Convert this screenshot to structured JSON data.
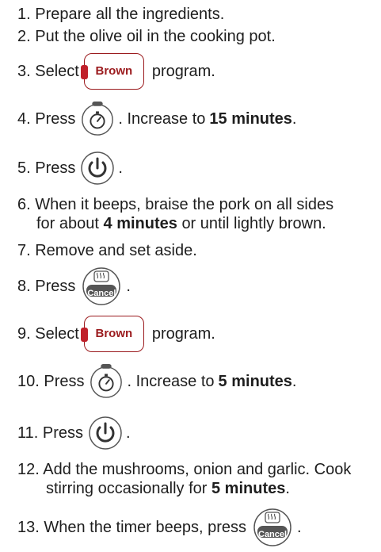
{
  "steps": {
    "s1": {
      "text": "1. Prepare all the ingredients."
    },
    "s2": {
      "text": "2. Put the olive oil in the cooking pot."
    },
    "s3": {
      "pre": "3. Select",
      "button": "Brown",
      "post": "program."
    },
    "s4": {
      "pre": "4. Press",
      "post": ". Increase to",
      "bold": "15 minutes",
      "end": "."
    },
    "s5": {
      "pre": "5. Press",
      "post": "."
    },
    "s6": {
      "l1": "6. When it beeps, braise the pork on all sides",
      "l2pre": "for about",
      "bold": "4 minutes",
      "l2post": "or until lightly brown."
    },
    "s7": {
      "text": "7. Remove and set aside."
    },
    "s8": {
      "pre": "8. Press",
      "post": "."
    },
    "s9": {
      "pre": "9. Select",
      "button": "Brown",
      "post": "program."
    },
    "s10": {
      "pre": "10. Press",
      "post": ". Increase to",
      "bold": "5 minutes",
      "end": "."
    },
    "s11": {
      "pre": "11. Press",
      "post": "."
    },
    "s12": {
      "l1": "12. Add the mushrooms, onion and garlic. Cook",
      "l2pre": "stirring occasionally for",
      "bold": "5 minutes",
      "end": "."
    },
    "s13": {
      "pre": "13. When the timer beeps, press",
      "post": "."
    }
  },
  "cancel_label": "Cancel",
  "colors": {
    "brand_red": "#9b1b1e",
    "icon_gray": "#555555",
    "text": "#1e1e1e"
  }
}
